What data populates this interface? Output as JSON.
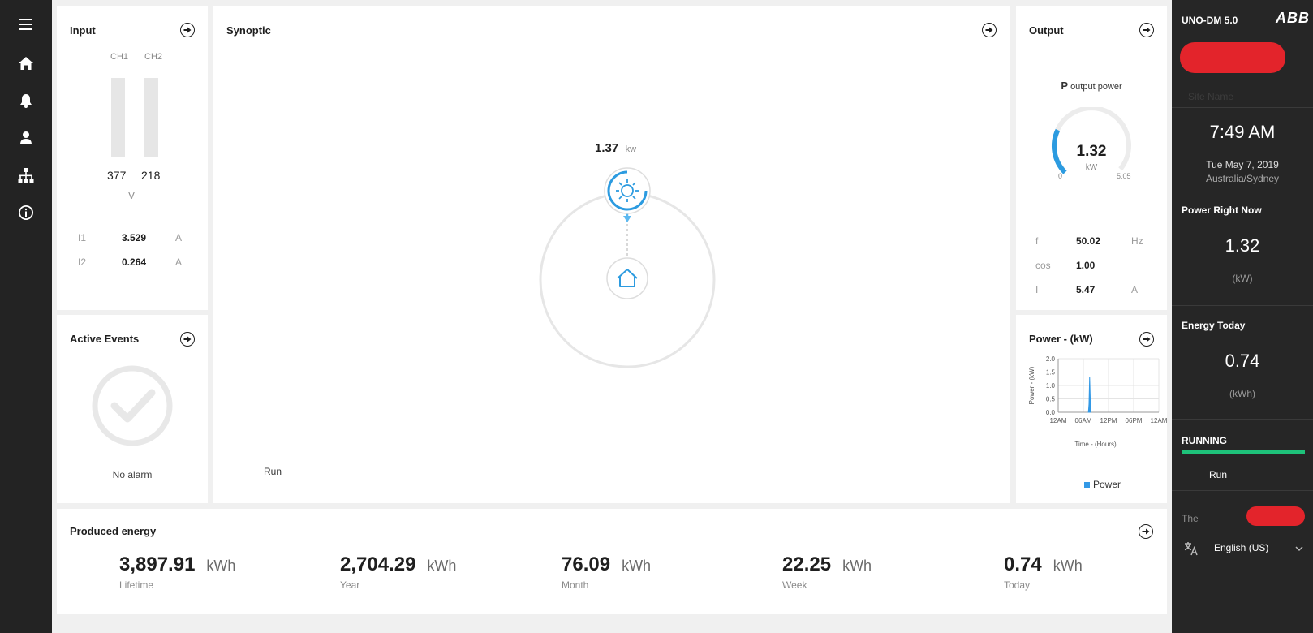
{
  "nav": {
    "items": [
      "menu-icon",
      "home-icon",
      "bell-icon",
      "user-icon",
      "network-icon",
      "info-icon"
    ]
  },
  "input": {
    "title": "Input",
    "ch1_label": "CH1",
    "ch2_label": "CH2",
    "ch1_value": "377",
    "ch2_value": "218",
    "voltage_unit": "V",
    "rows": [
      {
        "label": "I1",
        "value": "3.529",
        "unit": "A"
      },
      {
        "label": "I2",
        "value": "0.264",
        "unit": "A"
      }
    ]
  },
  "synoptic": {
    "title": "Synoptic",
    "pv_power": "1.37",
    "pv_unit": "kw",
    "status": "Run"
  },
  "output": {
    "title": "Output",
    "gauge_title_bold": "P",
    "gauge_title": "output power",
    "gauge_value": "1.32",
    "gauge_unit": "kW",
    "gauge_min": "0",
    "gauge_max": "5.05",
    "gauge_fraction": 0.261,
    "rows": [
      {
        "label": "f",
        "value": "50.02",
        "unit": "Hz"
      },
      {
        "label": "cos",
        "value": "1.00",
        "unit": ""
      },
      {
        "label": "I",
        "value": "5.47",
        "unit": "A"
      }
    ]
  },
  "events": {
    "title": "Active Events",
    "message": "No alarm"
  },
  "power_chart": {
    "title": "Power - (kW)",
    "legend": "Power",
    "color": "#3399e6"
  },
  "chart_data": {
    "type": "area",
    "xlabel": "Time - (Hours)",
    "ylabel": "Power - (kW)",
    "ylim": [
      0,
      2.0
    ],
    "y_ticks": [
      "2.0",
      "1.5",
      "1.0",
      "0.5",
      "0.0"
    ],
    "x_ticks": [
      "12AM",
      "06AM",
      "12PM",
      "06PM",
      "12AM"
    ],
    "grid": true,
    "legend_position": "bottom",
    "series": [
      {
        "name": "Power",
        "x": [
          7.2,
          7.35,
          7.5,
          7.65,
          7.8
        ],
        "values": [
          0.0,
          0.3,
          1.32,
          0.5,
          0.0
        ]
      }
    ]
  },
  "produced_energy": {
    "title": "Produced energy",
    "items": [
      {
        "value": "3,897.91",
        "unit": "kWh",
        "label": "Lifetime"
      },
      {
        "value": "2,704.29",
        "unit": "kWh",
        "label": "Year"
      },
      {
        "value": "76.09",
        "unit": "kWh",
        "label": "Month"
      },
      {
        "value": "22.25",
        "unit": "kWh",
        "label": "Week"
      },
      {
        "value": "0.74",
        "unit": "kWh",
        "label": "Today"
      }
    ]
  },
  "side": {
    "model": "UNO-DM 5.0",
    "brand": "ABB",
    "site_placeholder": "Site Name",
    "time": "7:49 AM",
    "date": "Tue May 7, 2019",
    "timezone": "Australia/Sydney",
    "power_title": "Power Right Now",
    "power_value": "1.32",
    "power_unit": "(kW)",
    "energy_title": "Energy Today",
    "energy_value": "0.74",
    "energy_unit": "(kWh)",
    "state_title": "RUNNING",
    "state_color": "#1ec27a",
    "state_text": "Run",
    "user_prefix": "The",
    "language": "English (US)"
  }
}
